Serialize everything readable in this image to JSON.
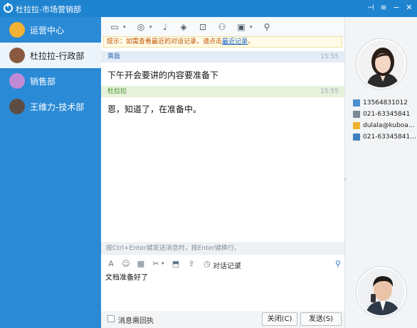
{
  "window": {
    "title": "杜拉拉-市场营销部",
    "pin_glyph": "⊣",
    "menu_glyph": "≡",
    "minimize_glyph": "−",
    "maximize_glyph": "□",
    "close_glyph": "✕"
  },
  "sidebar": {
    "items": [
      {
        "label": "运营中心",
        "avatar_color": "#f2b233"
      },
      {
        "label": "杜拉拉-行政部",
        "avatar_color": "#8a5a40"
      },
      {
        "label": "销售部",
        "avatar_color": "#c08ad6"
      },
      {
        "label": "王维力-技术部",
        "avatar_color": "#5e4d44"
      }
    ]
  },
  "toolbar": {
    "icons": [
      "folder-icon",
      "target-icon",
      "microphone-icon",
      "screenshot-icon",
      "share-screen-icon",
      "add-user-icon",
      "task-icon",
      "location-icon"
    ],
    "glyphs": [
      "▭",
      "◎",
      "♩",
      "◈",
      "⊡",
      "⚇",
      "▣",
      "⚲"
    ],
    "dropdown_glyph": "▾"
  },
  "notice": {
    "prefix": "提示：如需查看最近的对话记录，请点击",
    "link": "最近记录",
    "suffix": "。"
  },
  "messages": [
    {
      "sender": "黄磊",
      "time": "15:55",
      "text": "下午开会要讲的内容要准备下",
      "sender_color": "#3070b8",
      "header_bg": "#e4edf6"
    },
    {
      "sender": "杜拉拉",
      "time": "15:55",
      "text": "恩，知道了，在准备中。",
      "sender_color": "#3a8a20",
      "header_bg": "#e6f2dc"
    }
  ],
  "input": {
    "hint": "按Ctrl+Enter键发送消息时，按Enter键换行。",
    "history_label": "对话记录",
    "draft": "文档准备好了",
    "icons": [
      "font-icon",
      "emoji-icon",
      "image-icon",
      "scissors-icon",
      "screen-capture-icon",
      "file-send-icon",
      "history-icon",
      "search-icon"
    ],
    "glyphs": [
      "A",
      "☺",
      "▦",
      "✂",
      "⬒",
      "⇪",
      "◷",
      "⚲"
    ]
  },
  "bottom": {
    "receipt_label": "消息需回执",
    "close_label": "关闭(C)",
    "send_label": "发送(S)"
  },
  "contact": {
    "mobile": "13564831012",
    "phone": "021-63345841",
    "email": "dulala@kuboa...",
    "fax": "021-63345841..."
  },
  "colors": {
    "accent": "#1f84d0",
    "sidebar": "#2a8ad6",
    "notice_text": "#c05000"
  }
}
